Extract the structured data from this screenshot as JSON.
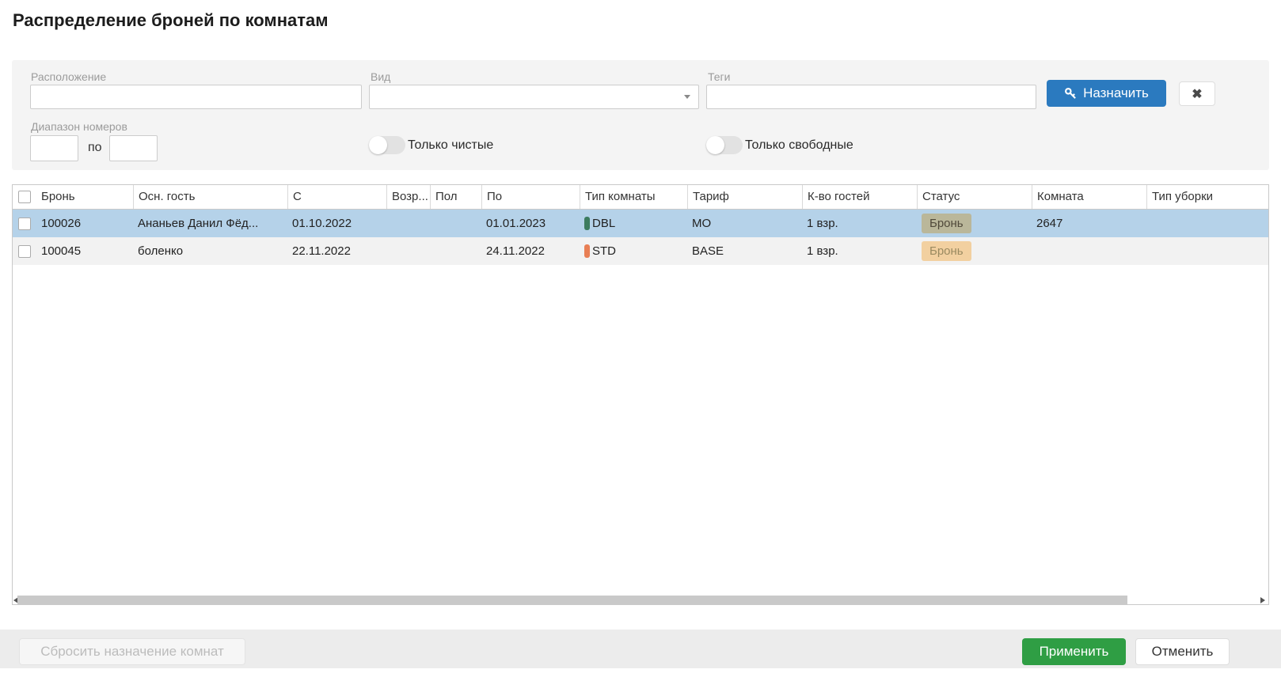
{
  "title": "Распределение броней по комнатам",
  "filters": {
    "location_label": "Расположение",
    "location_value": "",
    "view_label": "Вид",
    "view_value": "",
    "tags_label": "Теги",
    "tags_value": "",
    "assign_button_label": "Назначить",
    "clear_button_icon": "✖",
    "range_label": "Диапазон номеров",
    "range_from_value": "",
    "range_separator": "по",
    "range_to_value": "",
    "only_clean_label": "Только чистые",
    "only_clean_on": false,
    "only_free_label": "Только свободные",
    "only_free_on": false
  },
  "table": {
    "columns": [
      "Бронь",
      "Осн. гость",
      "С",
      "Возр...",
      "Пол",
      "По",
      "Тип комнаты",
      "Тариф",
      "К-во гостей",
      "Статус",
      "Комната",
      "Тип уборки"
    ],
    "rows": [
      {
        "booking": "100026",
        "guest": "Ананьев Данил Фёд...",
        "date_from": "01.10.2022",
        "age": "",
        "sex": "",
        "date_to": "01.01.2023",
        "room_type": "DBL",
        "room_type_color": "#3d7c5f",
        "tariff": "МО",
        "guest_count": "1 взр.",
        "status": "Бронь",
        "room": "2647",
        "cleaning_type": "",
        "selected": true
      },
      {
        "booking": "100045",
        "guest": "боленко",
        "date_from": "22.11.2022",
        "age": "",
        "sex": "",
        "date_to": "24.11.2022",
        "room_type": "STD",
        "room_type_color": "#e87f55",
        "tariff": "BASE",
        "guest_count": "1 взр.",
        "status": "Бронь",
        "room": "",
        "cleaning_type": "",
        "selected": false
      }
    ]
  },
  "footer": {
    "reset_button_label": "Сбросить назначение комнат",
    "apply_button_label": "Применить",
    "cancel_button_label": "Отменить"
  },
  "colors": {
    "assign_button": "#2b7abf",
    "apply_button": "#2f9e44",
    "selected_row": "#b5d2e9",
    "status_badge": "#f2ae4e"
  }
}
